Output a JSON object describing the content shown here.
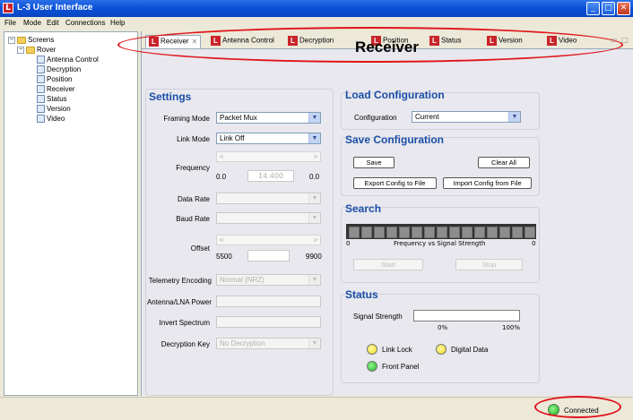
{
  "window": {
    "title": "L-3 User Interface"
  },
  "menu": [
    "File",
    "Mode",
    "Edit",
    "Connections",
    "Help"
  ],
  "tree": {
    "root": "Screens",
    "group": "Rover",
    "items": [
      "Antenna Control",
      "Decryption",
      "Position",
      "Receiver",
      "Status",
      "Version",
      "Video"
    ]
  },
  "tabs": [
    "Receiver",
    "Antenna Control",
    "Decryption",
    "Position",
    "Status",
    "Version",
    "Video"
  ],
  "page_title": "Receiver",
  "settings": {
    "title": "Settings",
    "framing_mode_label": "Framing Mode",
    "framing_mode_value": "Packet Mux",
    "link_mode_label": "Link Mode",
    "link_mode_value": "Link Off",
    "frequency_label": "Frequency",
    "frequency_min": "0.0",
    "frequency_value": "14.400",
    "frequency_max": "0.0",
    "data_rate_label": "Data Rate",
    "baud_rate_label": "Baud Rate",
    "offset_label": "Offset",
    "offset_min": "5500",
    "offset_max": "9900",
    "telemetry_label": "Telemetry Encoding",
    "telemetry_value": "Normal (NRZ)",
    "antenna_lna_label": "Antenna/LNA Power",
    "invert_spectrum_label": "Invert Spectrum",
    "decryption_key_label": "Decryption Key",
    "decryption_key_value": "No Decryption"
  },
  "load_config": {
    "title": "Load Configuration",
    "configuration_label": "Configuration",
    "configuration_value": "Current"
  },
  "save_config": {
    "title": "Save Configuration",
    "save_label": "Save",
    "clear_all_label": "Clear All",
    "export_label": "Export Config to File",
    "import_label": "Import Config from File"
  },
  "search": {
    "title": "Search",
    "meter_left": "0",
    "meter_caption": "Frequency vs Signal Strength",
    "meter_right": "0",
    "start_label": "Start",
    "stop_label": "Stop"
  },
  "status": {
    "title": "Status",
    "signal_strength_label": "Signal Strength",
    "signal_min": "0%",
    "signal_max": "100%",
    "link_lock_label": "Link Lock",
    "digital_data_label": "Digital Data",
    "front_panel_label": "Front Panel"
  },
  "statusbar": {
    "connection_label": "Connected"
  },
  "colors": {
    "led_yellow": "#f2dc1b",
    "led_green": "#23b523",
    "annotation": "#e0141a"
  }
}
